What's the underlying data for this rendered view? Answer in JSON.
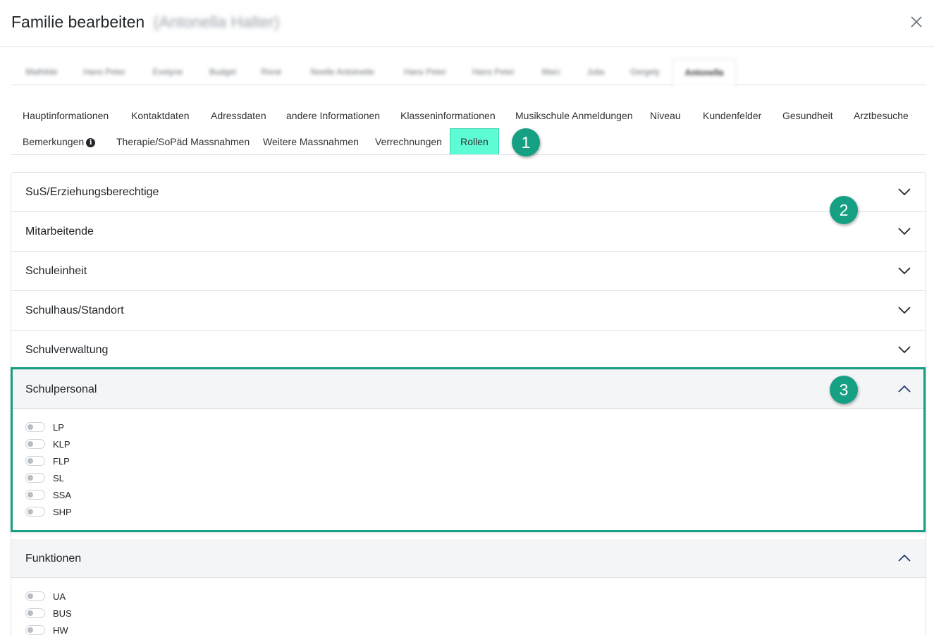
{
  "dialog": {
    "title": "Familie bearbeiten",
    "blurred_name": "(Antonella Halter)"
  },
  "member_tabs": [
    {
      "label": "Mathilde"
    },
    {
      "label": "Hans Peter"
    },
    {
      "label": "Evelyne"
    },
    {
      "label": "Budget"
    },
    {
      "label": "René"
    },
    {
      "label": "Noelle Antoinette"
    },
    {
      "label": "Hans Peter"
    },
    {
      "label": "Hans Peter"
    },
    {
      "label": "Marc"
    },
    {
      "label": "Julia"
    },
    {
      "label": "Gergely"
    },
    {
      "label": "Antonella"
    }
  ],
  "section_tabs": {
    "row1": [
      {
        "label": "Hauptinformationen"
      },
      {
        "label": "Kontaktdaten"
      },
      {
        "label": "Adressdaten"
      },
      {
        "label": "andere Informationen"
      },
      {
        "label": "Klasseninformationen"
      },
      {
        "label": "Musikschule Anmeldungen"
      },
      {
        "label": "Niveau"
      },
      {
        "label": "Kundenfelder"
      },
      {
        "label": "Gesundheit"
      },
      {
        "label": "Arztbesuche"
      }
    ],
    "row2": [
      {
        "label": "Bemerkungen"
      },
      {
        "label": "Therapie/SoPäd Massnahmen"
      },
      {
        "label": "Weitere Massnahmen"
      },
      {
        "label": "Verrechnungen"
      },
      {
        "label": "Rollen"
      }
    ],
    "active": "Rollen"
  },
  "markers": [
    "1",
    "2",
    "3"
  ],
  "accordion": [
    {
      "label": "SuS/Erziehungsberechtige",
      "open": false
    },
    {
      "label": "Mitarbeitende",
      "open": false
    },
    {
      "label": "Schuleinheit",
      "open": false
    },
    {
      "label": "Schulhaus/Standort",
      "open": false
    },
    {
      "label": "Schulverwaltung",
      "open": false
    },
    {
      "label": "Schulpersonal",
      "open": true,
      "toggles": [
        {
          "label": "LP",
          "on": false
        },
        {
          "label": "KLP",
          "on": false
        },
        {
          "label": "FLP",
          "on": false
        },
        {
          "label": "SL",
          "on": false
        },
        {
          "label": "SSA",
          "on": false
        },
        {
          "label": "SHP",
          "on": false
        }
      ]
    },
    {
      "label": "Funktionen",
      "open": true,
      "toggles": [
        {
          "label": "UA",
          "on": false
        },
        {
          "label": "BUS",
          "on": false
        },
        {
          "label": "HW",
          "on": false
        }
      ]
    }
  ],
  "colors": {
    "active_tab": "#5dfcd4",
    "marker": "#16a083",
    "highlight_border": "#16a083"
  },
  "icons": {
    "close": "close-icon",
    "info": "info-icon",
    "chevron_down": "chevron-down-icon",
    "chevron_up": "chevron-up-icon"
  }
}
